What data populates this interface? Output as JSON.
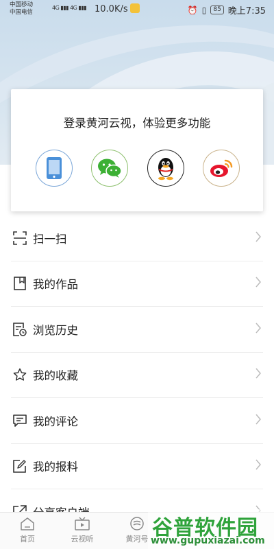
{
  "status_bar": {
    "carrier_1": "中国移动",
    "carrier_2": "中国电信",
    "signal_text": "4G ▮▮▮ 4G ▮▮▮",
    "net_speed": "10.0K/s",
    "battery": "85",
    "time": "晚上7:35"
  },
  "login_card": {
    "title": "登录黄河云视，体验更多功能",
    "options": [
      {
        "name": "phone-login-button",
        "icon": "phone-icon"
      },
      {
        "name": "wechat-login-button",
        "icon": "wechat-icon"
      },
      {
        "name": "qq-login-button",
        "icon": "qq-icon"
      },
      {
        "name": "weibo-login-button",
        "icon": "weibo-icon"
      }
    ]
  },
  "menu": {
    "items": [
      {
        "label": "扫一扫",
        "icon": "scan-icon"
      },
      {
        "label": "我的作品",
        "icon": "bookmark-icon"
      },
      {
        "label": "浏览历史",
        "icon": "history-icon"
      },
      {
        "label": "我的收藏",
        "icon": "star-icon"
      },
      {
        "label": "我的评论",
        "icon": "comment-icon"
      },
      {
        "label": "我的报料",
        "icon": "edit-icon"
      },
      {
        "label": "分享客户端",
        "icon": "share-icon"
      }
    ]
  },
  "tabbar": {
    "tabs": [
      {
        "label": "首页",
        "icon": "home-icon"
      },
      {
        "label": "云视听",
        "icon": "tv-icon"
      },
      {
        "label": "黄河号",
        "icon": "yellow-river-icon"
      }
    ]
  },
  "watermark": {
    "title": "谷普软件园",
    "url": "www.gupuxiazai.com"
  },
  "colors": {
    "hero_bg": "#d6e4ef",
    "wechat": "#3cb034",
    "weibo": "#e6162d",
    "phone": "#4a90d9"
  }
}
